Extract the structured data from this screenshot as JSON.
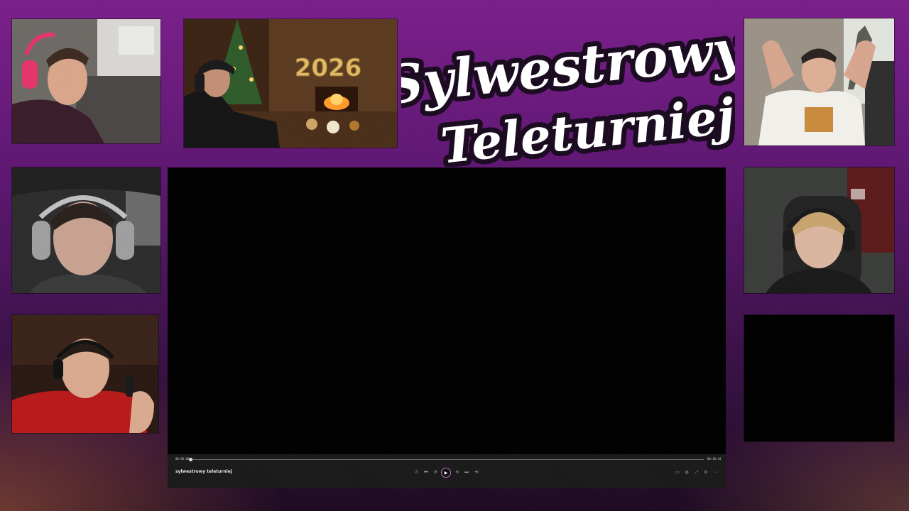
{
  "overlay": {
    "logo_line1": "Sylwestrowy",
    "logo_line2": "Teleturniej",
    "scene_banner": "2026"
  },
  "player": {
    "title": "sylwestrowy teleturniej",
    "time_current": "00:00:00",
    "time_total": "00:18:44",
    "progress": 0.0,
    "controls": [
      "shuffle-icon",
      "previous-icon",
      "rewind-10-icon",
      "play-icon",
      "forward-10-icon",
      "next-icon",
      "repeat-icon"
    ],
    "right_controls": [
      "miniplayer-icon",
      "cast-icon",
      "fullscreen-icon",
      "settings-icon",
      "more-icon"
    ],
    "accent": "#c46cd0"
  },
  "colors": {
    "background_top": "#7a1f8a",
    "background_bottom": "#1d0a22",
    "logo_text": "#ffffff",
    "logo_outline": "#1a0a1f"
  }
}
